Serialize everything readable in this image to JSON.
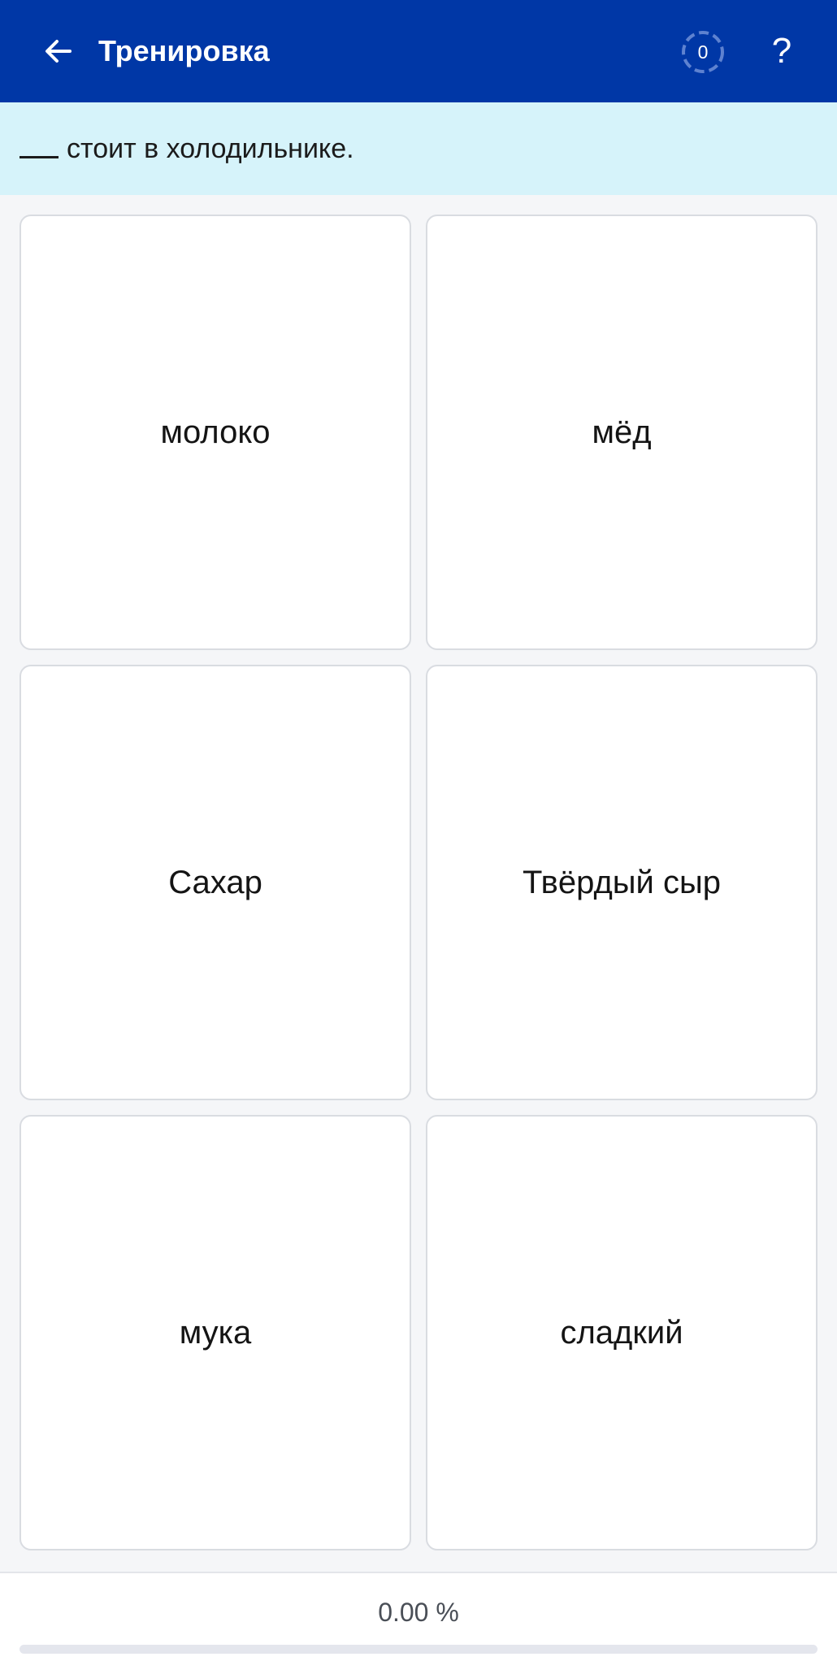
{
  "header": {
    "title": "Тренировка",
    "back_icon": "arrow-left-icon",
    "score_count": "0",
    "help_label": "?",
    "background_color": "#0037a6"
  },
  "prompt": {
    "sentence": "стоит в холодильнике.",
    "background_color": "#d6f3fa"
  },
  "answers": [
    {
      "label": "молоко"
    },
    {
      "label": "мёд"
    },
    {
      "label": "Сахар"
    },
    {
      "label": "Твёрдый сыр"
    },
    {
      "label": "мука"
    },
    {
      "label": "сладкий"
    }
  ],
  "progress": {
    "percent_text": "0.00 %",
    "fraction": 0.0
  }
}
